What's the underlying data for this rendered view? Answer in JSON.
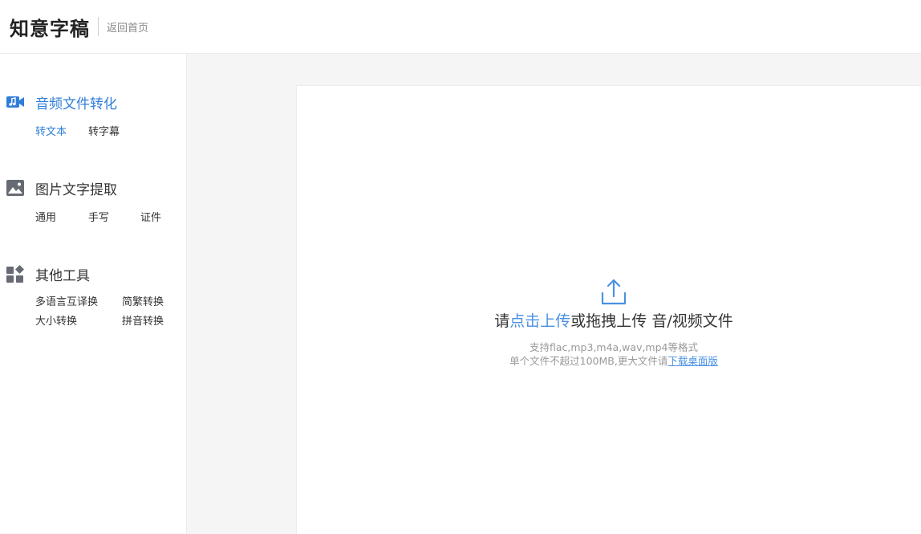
{
  "header": {
    "logo": "知意字稿",
    "back_link": "返回首页"
  },
  "sidebar": {
    "groups": [
      {
        "title": "音频文件转化",
        "icon": "audio-video-icon",
        "items": [
          "转文本",
          "转字幕"
        ]
      },
      {
        "title": "图片文字提取",
        "icon": "image-icon",
        "items": [
          "通用",
          "手写",
          "证件"
        ]
      },
      {
        "title": "其他工具",
        "icon": "apps-icon",
        "items": [
          "多语言互译换",
          "简繁转换",
          "大小转换",
          "拼音转换"
        ]
      }
    ]
  },
  "upload": {
    "prefix": "请",
    "click_link": "点击上传",
    "suffix": "或拖拽上传 音/视频文件",
    "hint_formats": "支持flac,mp3,m4a,wav,mp4等格式",
    "hint_size": "单个文件不超过100MB,更大文件请",
    "desktop_link": "下载桌面版"
  },
  "colors": {
    "accent": "#2f7ed8",
    "link": "#4a90e2",
    "icon_gray": "#666a73"
  }
}
